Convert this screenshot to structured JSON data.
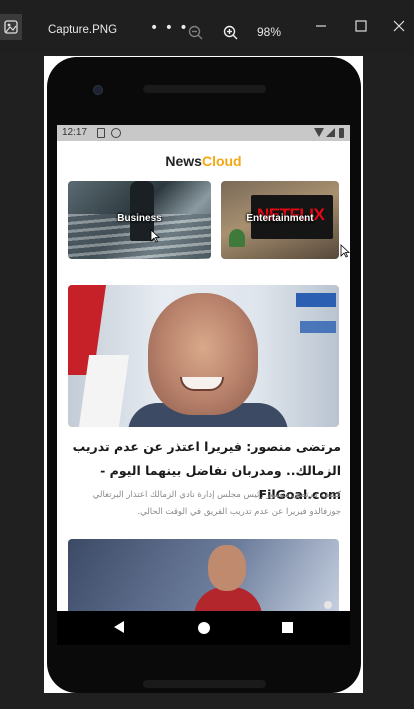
{
  "viewer": {
    "file_name": "Capture.PNG",
    "more_label": "• • •",
    "zoom_level": "98%",
    "icons": [
      "photos-app-icon",
      "zoom-out-icon",
      "zoom-in-icon",
      "minimize-icon",
      "maximize-icon",
      "close-icon"
    ]
  },
  "phone": {
    "status_time": "12:17",
    "app_logo": {
      "part1": "News",
      "part2": "Cloud"
    },
    "categories": [
      {
        "label": "Business"
      },
      {
        "label": "Entertainment",
        "tv_brand": "NETFLIX"
      }
    ],
    "articles": [
      {
        "headline": "مرتضى منصور: فيريرا اعتذر عن عدم تدريب الزمالك.. ومدربان نفاضل بينهما اليوم - FilGoal.com",
        "summary": "كشف مرتضى منصور رئيس مجلس إدارة نادي الزمالك اعتذار البرتغالي جوزفالدو فيريرا عن عدم تدريب الفريق في الوقت الحالي."
      }
    ],
    "nav_buttons": [
      "back",
      "home",
      "recents"
    ]
  },
  "colors": {
    "brand_accent": "#f3a712",
    "viewer_bg": "#202020",
    "status_bar": "#c8c8c8"
  }
}
